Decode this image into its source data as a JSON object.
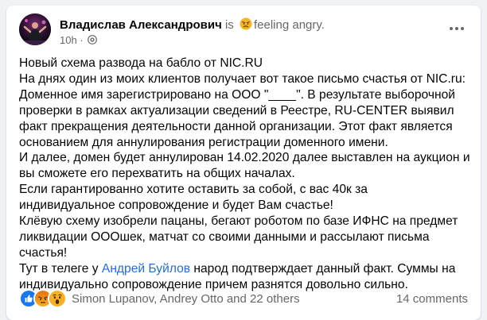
{
  "post": {
    "author": "Владислав Александрович",
    "activity_prefix": "is",
    "activity": "feeling angry.",
    "time": "10h",
    "lines": [
      "Новый схема развода на бабло от NIC.RU",
      "На днях один из моих клиентов получает вот такое письмо счастья от NIC.ru:",
      "Доменное имя зарегистрировано на ООО \"____\". В результате выборочной",
      "проверки в рамках актуализации сведений в Реестре, RU-CENTER выявил",
      "факт прекращения деятельности данной организации. Этот факт является",
      "основанием для аннулирования регистрации доменного имени.",
      "И далее, домен будет аннулирован 14.02.2020 далее выставлен на аукцион и",
      "вы сможете его перехватить на общих началах.",
      "Если гарантированно хотите оставить за собой, с вас 40к за",
      "индивидуальное сопровождение и будет Вам счастье!",
      "Клёвую схему изобрели пацаны, бегают роботом по базе ИФНС на предмет",
      "ликвидации ОООшек, матчат со своими данными и рассылают письма",
      "счастья!"
    ],
    "mention_line_prefix": "Тут в телеге у ",
    "mention_name": "Андрей Буйлов",
    "mention_line_suffix": " народ подтверждает данный факт. Суммы на",
    "last_line": "индивидуально сопровождение причем разнятся довольно сильно."
  },
  "footer": {
    "reactors": "Simon Lupanov, Andrey Otto and 22 others",
    "comments": "14 comments"
  },
  "icons": {
    "feeling": "angry-face-icon",
    "privacy": "globe-icon",
    "more": "more-horizontal-icon",
    "reactions": [
      "like-icon",
      "angry-reaction-icon",
      "wow-reaction-icon"
    ]
  },
  "colors": {
    "link": "#216fdb",
    "muted": "#65676b",
    "like": "#1877f2",
    "angry": "#e9710f",
    "wow": "#f7b125"
  }
}
